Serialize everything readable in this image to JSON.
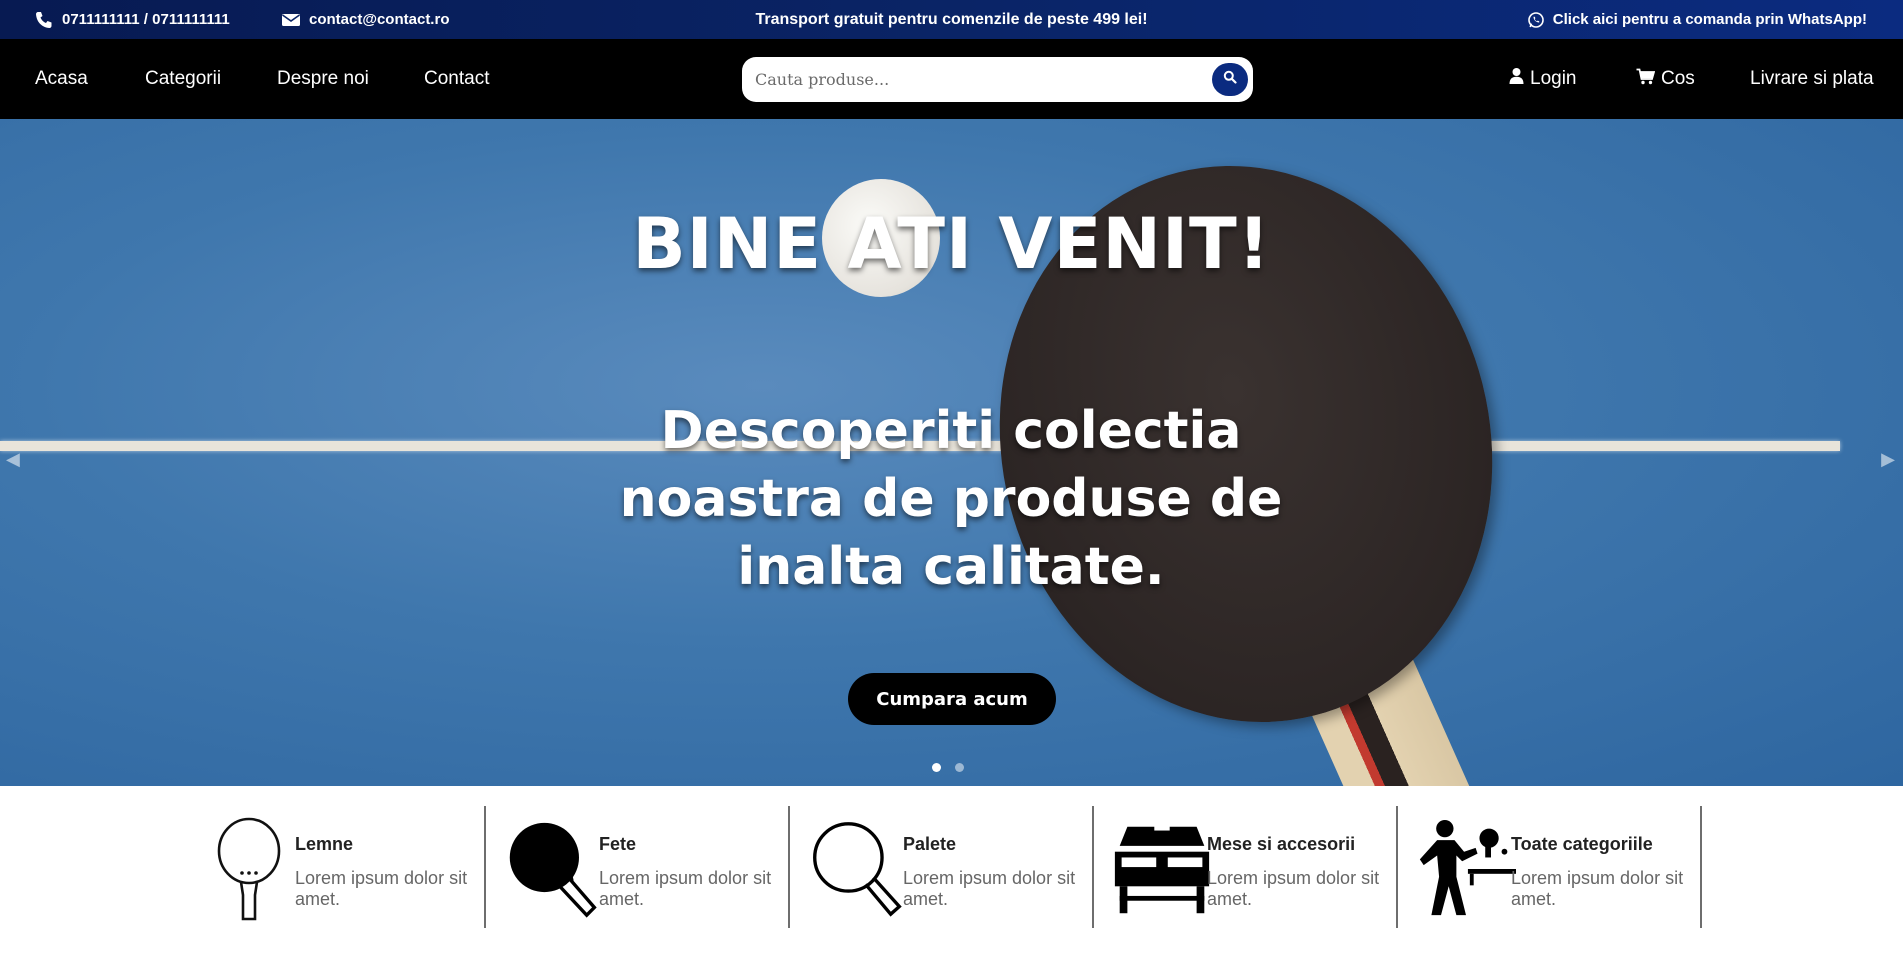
{
  "topbar": {
    "phone": "0711111111 / 0711111111",
    "email": "contact@contact.ro",
    "promo": "Transport gratuit pentru comenzile de peste 499 lei!",
    "whatsapp": "Click aici pentru a comanda prin WhatsApp!",
    "icons": [
      "phone-icon",
      "envelope-icon",
      "whatsapp-icon"
    ]
  },
  "nav": {
    "left": [
      "Acasa",
      "Categorii",
      "Despre noi",
      "Contact"
    ],
    "login": "Login",
    "cart": "Cos",
    "delivery": "Livrare si plata"
  },
  "search": {
    "placeholder": "Cauta produse...",
    "value": ""
  },
  "hero": {
    "title": "BINE ATI VENIT!",
    "subtitle": "Descoperiti colectia noastra de produse de inalta calitate.",
    "button": "Cumpara acum",
    "slide_count": 2,
    "active_slide": 1
  },
  "categories": [
    {
      "title": "Lemne",
      "desc": "Lorem ipsum dolor sit amet.",
      "icon": "blade-icon"
    },
    {
      "title": "Fete",
      "desc": "Lorem ipsum dolor sit amet.",
      "icon": "filled-paddle-icon"
    },
    {
      "title": "Palete",
      "desc": "Lorem ipsum dolor sit amet.",
      "icon": "outline-paddle-icon"
    },
    {
      "title": "Mese si accesorii",
      "desc": "Lorem ipsum dolor sit amet.",
      "icon": "table-icon"
    },
    {
      "title": "Toate categoriile",
      "desc": "Lorem ipsum dolor sit amet.",
      "icon": "player-icon"
    }
  ],
  "colors": {
    "topbar_bg": "#0a2466",
    "navbar_bg": "#000000",
    "accent": "#0b2b80",
    "hero_bg": "#3f77ad"
  }
}
